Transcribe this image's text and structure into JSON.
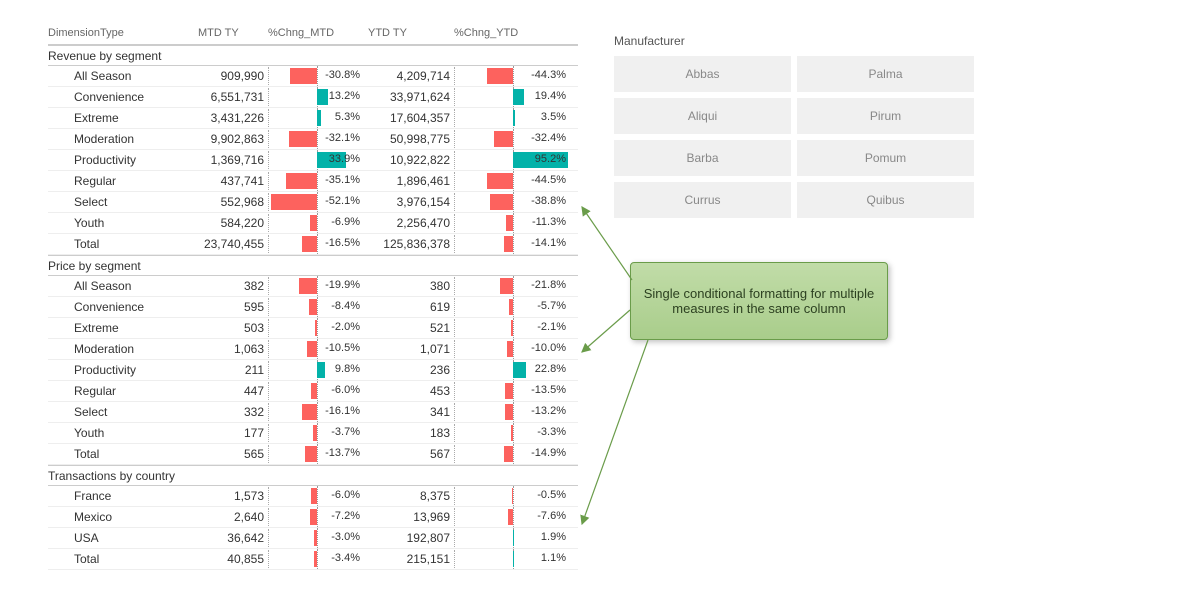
{
  "columns": {
    "dim": "DimensionType",
    "mtd": "MTD TY",
    "chmtd": "%Chng_MTD",
    "ytd": "YTD TY",
    "chytd": "%Chng_YTD"
  },
  "groups": [
    {
      "title": "Revenue by segment",
      "rows": [
        {
          "label": "All Season",
          "mtd": "909,990",
          "chmtd": -30.8,
          "chmtd_txt": "-30.8%",
          "ytd": "4,209,714",
          "chytd": -44.3,
          "chytd_txt": "-44.3%"
        },
        {
          "label": "Convenience",
          "mtd": "6,551,731",
          "chmtd": 13.2,
          "chmtd_txt": "13.2%",
          "ytd": "33,971,624",
          "chytd": 19.4,
          "chytd_txt": "19.4%"
        },
        {
          "label": "Extreme",
          "mtd": "3,431,226",
          "chmtd": 5.3,
          "chmtd_txt": "5.3%",
          "ytd": "17,604,357",
          "chytd": 3.5,
          "chytd_txt": "3.5%"
        },
        {
          "label": "Moderation",
          "mtd": "9,902,863",
          "chmtd": -32.1,
          "chmtd_txt": "-32.1%",
          "ytd": "50,998,775",
          "chytd": -32.4,
          "chytd_txt": "-32.4%"
        },
        {
          "label": "Productivity",
          "mtd": "1,369,716",
          "chmtd": 33.9,
          "chmtd_txt": "33.9%",
          "ytd": "10,922,822",
          "chytd": 95.2,
          "chytd_txt": "95.2%"
        },
        {
          "label": "Regular",
          "mtd": "437,741",
          "chmtd": -35.1,
          "chmtd_txt": "-35.1%",
          "ytd": "1,896,461",
          "chytd": -44.5,
          "chytd_txt": "-44.5%"
        },
        {
          "label": "Select",
          "mtd": "552,968",
          "chmtd": -52.1,
          "chmtd_txt": "-52.1%",
          "ytd": "3,976,154",
          "chytd": -38.8,
          "chytd_txt": "-38.8%"
        },
        {
          "label": "Youth",
          "mtd": "584,220",
          "chmtd": -6.9,
          "chmtd_txt": "-6.9%",
          "ytd": "2,256,470",
          "chytd": -11.3,
          "chytd_txt": "-11.3%"
        },
        {
          "label": "Total",
          "mtd": "23,740,455",
          "chmtd": -16.5,
          "chmtd_txt": "-16.5%",
          "ytd": "125,836,378",
          "chytd": -14.1,
          "chytd_txt": "-14.1%"
        }
      ]
    },
    {
      "title": "Price by segment",
      "rows": [
        {
          "label": "All Season",
          "mtd": "382",
          "chmtd": -19.9,
          "chmtd_txt": "-19.9%",
          "ytd": "380",
          "chytd": -21.8,
          "chytd_txt": "-21.8%"
        },
        {
          "label": "Convenience",
          "mtd": "595",
          "chmtd": -8.4,
          "chmtd_txt": "-8.4%",
          "ytd": "619",
          "chytd": -5.7,
          "chytd_txt": "-5.7%"
        },
        {
          "label": "Extreme",
          "mtd": "503",
          "chmtd": -2.0,
          "chmtd_txt": "-2.0%",
          "ytd": "521",
          "chytd": -2.1,
          "chytd_txt": "-2.1%"
        },
        {
          "label": "Moderation",
          "mtd": "1,063",
          "chmtd": -10.5,
          "chmtd_txt": "-10.5%",
          "ytd": "1,071",
          "chytd": -10.0,
          "chytd_txt": "-10.0%"
        },
        {
          "label": "Productivity",
          "mtd": "211",
          "chmtd": 9.8,
          "chmtd_txt": "9.8%",
          "ytd": "236",
          "chytd": 22.8,
          "chytd_txt": "22.8%"
        },
        {
          "label": "Regular",
          "mtd": "447",
          "chmtd": -6.0,
          "chmtd_txt": "-6.0%",
          "ytd": "453",
          "chytd": -13.5,
          "chytd_txt": "-13.5%"
        },
        {
          "label": "Select",
          "mtd": "332",
          "chmtd": -16.1,
          "chmtd_txt": "-16.1%",
          "ytd": "341",
          "chytd": -13.2,
          "chytd_txt": "-13.2%"
        },
        {
          "label": "Youth",
          "mtd": "177",
          "chmtd": -3.7,
          "chmtd_txt": "-3.7%",
          "ytd": "183",
          "chytd": -3.3,
          "chytd_txt": "-3.3%"
        },
        {
          "label": "Total",
          "mtd": "565",
          "chmtd": -13.7,
          "chmtd_txt": "-13.7%",
          "ytd": "567",
          "chytd": -14.9,
          "chytd_txt": "-14.9%"
        }
      ]
    },
    {
      "title": "Transactions by country",
      "rows": [
        {
          "label": "France",
          "mtd": "1,573",
          "chmtd": -6.0,
          "chmtd_txt": "-6.0%",
          "ytd": "8,375",
          "chytd": -0.5,
          "chytd_txt": "-0.5%"
        },
        {
          "label": "Mexico",
          "mtd": "2,640",
          "chmtd": -7.2,
          "chmtd_txt": "-7.2%",
          "ytd": "13,969",
          "chytd": -7.6,
          "chytd_txt": "-7.6%"
        },
        {
          "label": "USA",
          "mtd": "36,642",
          "chmtd": -3.0,
          "chmtd_txt": "-3.0%",
          "ytd": "192,807",
          "chytd": 1.9,
          "chytd_txt": "1.9%"
        },
        {
          "label": "Total",
          "mtd": "40,855",
          "chmtd": -3.4,
          "chmtd_txt": "-3.4%",
          "ytd": "215,151",
          "chytd": 1.1,
          "chytd_txt": "1.1%"
        }
      ]
    }
  ],
  "slicer": {
    "title": "Manufacturer",
    "items": [
      "Abbas",
      "Palma",
      "Aliqui",
      "Pirum",
      "Barba",
      "Pomum",
      "Currus",
      "Quibus"
    ]
  },
  "callout": "Single conditional formatting for multiple measures in the same column",
  "chart_data": {
    "type": "table",
    "note": "Matrix visual with inline data bars on %Chng_MTD and %Chng_YTD columns. Negative values red (#fd625e), positive teal (#03b2a9).",
    "mtd_scale_max_abs": 55,
    "ytd_scale_max_abs": 100
  }
}
